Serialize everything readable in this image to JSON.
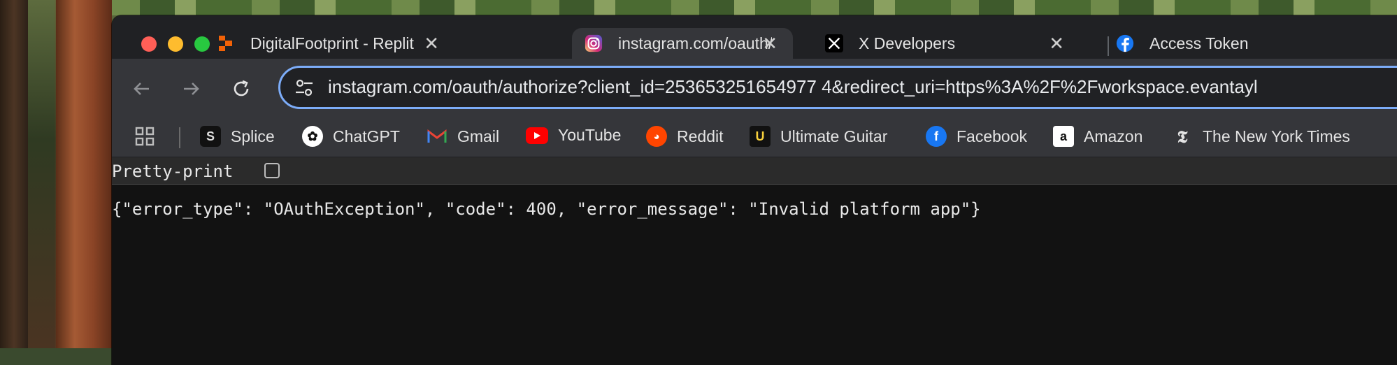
{
  "tabs": [
    {
      "title": "DigitalFootprint - Replit",
      "icon": "replit-icon",
      "active": false
    },
    {
      "title": "instagram.com/oauth/authoriz",
      "icon": "instagram-icon",
      "active": true
    },
    {
      "title": "X Developers",
      "icon": "x-icon",
      "active": false
    },
    {
      "title": "Access Token",
      "icon": "facebook-icon",
      "active": false
    }
  ],
  "tab_close_glyph": "✕",
  "toolbar": {
    "url": "instagram.com/oauth/authorize?client_id=253653251654977 4&redirect_uri=https%3A%2F%2Fworkspace.evantayl",
    "back_icon": "back-arrow-icon",
    "forward_icon": "forward-arrow-icon",
    "reload_icon": "reload-icon"
  },
  "bookmarks": [
    {
      "label": "Splice",
      "icon": "splice-icon"
    },
    {
      "label": "ChatGPT",
      "icon": "chatgpt-icon"
    },
    {
      "label": "Gmail",
      "icon": "gmail-icon"
    },
    {
      "label": "YouTube",
      "icon": "youtube-icon"
    },
    {
      "label": "Reddit",
      "icon": "reddit-icon"
    },
    {
      "label": "Ultimate Guitar",
      "icon": "ultimate-guitar-icon"
    },
    {
      "label": "Facebook",
      "icon": "facebook-icon"
    },
    {
      "label": "Amazon",
      "icon": "amazon-icon"
    },
    {
      "label": "The New York Times",
      "icon": "nyt-icon"
    }
  ],
  "content": {
    "pretty_print_label": "Pretty-print",
    "pretty_print_checked": false,
    "json_text": "{\"error_type\": \"OAuthException\", \"code\": 400, \"error_message\": \"Invalid platform app\"}"
  },
  "colors": {
    "omnibox_border": "#7cacf8",
    "tab_active_bg": "#35363a",
    "tabstrip_bg": "#202124"
  }
}
